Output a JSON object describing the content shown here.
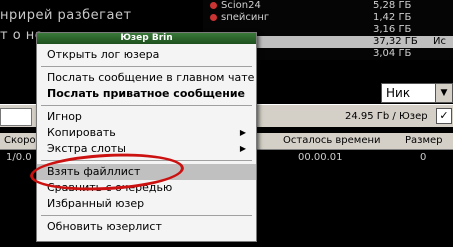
{
  "chat": {
    "line1": "нрирей разбегает",
    "line2": "т о не"
  },
  "userlist": {
    "rows": [
      {
        "name": "Scion24",
        "size": "5,28 ГБ",
        "extra": ""
      },
      {
        "name": "sпейсинг",
        "size": "1,42 ГБ",
        "extra": ""
      },
      {
        "name": "",
        "size": "3,16 ГБ",
        "extra": ""
      },
      {
        "name": "",
        "size": "37,32 ГБ",
        "extra": "Ис"
      },
      {
        "name": "",
        "size": "3,04 ГБ",
        "extra": ""
      }
    ]
  },
  "toolbar": {
    "nick_label": "Ник",
    "speed": "24.95 Гb / Юзер"
  },
  "columns": {
    "c1": "Скоро",
    "c2": "Осталось времени",
    "c3": "Размер"
  },
  "queue": {
    "v1": "1/0.0",
    "v2": "00.00.01",
    "v3": "0"
  },
  "menu": {
    "title": "Юзер Brin",
    "items": [
      "Открыть лог юзера",
      "Послать сообщение в главном чате",
      "Послать приватное сообщение",
      "Игнор",
      "Копировать",
      "Экстра слоты",
      "Взять файллист",
      "Сравнить с очередью",
      "Избранный юзер",
      "Обновить юзерлист"
    ]
  },
  "colors": {
    "annotation": "#cc1111",
    "menu_title": "#2e6b2e"
  }
}
